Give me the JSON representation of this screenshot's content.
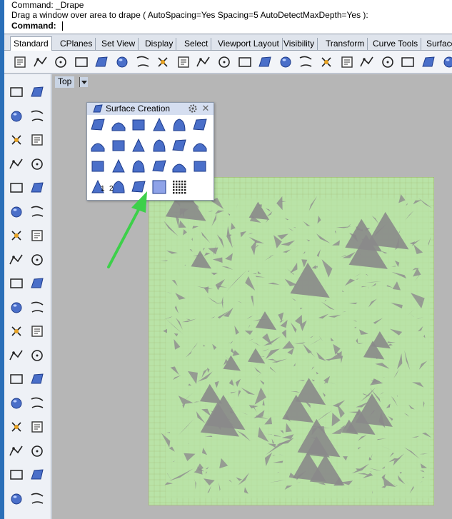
{
  "command": {
    "line1": "Command: _Drape",
    "line2": "Drag a window over area to drape ( AutoSpacing=Yes  Spacing=5  AutoDetectMaxDepth=Yes ):",
    "prompt": "Command:",
    "input_value": ""
  },
  "tabs": [
    "Standard",
    "CPlanes",
    "Set View",
    "Display",
    "Select",
    "Viewport Layout",
    "Visibility",
    "Transform",
    "Curve Tools",
    "Surface"
  ],
  "toolbar_icons": [
    "new-file-icon",
    "open-folder-icon",
    "save-icon",
    "print-icon",
    "import-icon",
    "cut-icon",
    "copy-icon",
    "paste-icon",
    "undo-icon",
    "pan-hand-icon",
    "rotate-view-icon",
    "zoom-icon",
    "zoom-window-icon",
    "zoom-extents-icon",
    "zoom-selected-icon",
    "rotate-camera-icon",
    "four-viewports-icon",
    "car-render-icon",
    "drafting-icon",
    "properties-icon",
    "snap-icon",
    "light-bulb-icon"
  ],
  "left_tools": [
    "select-arrow-icon",
    "point-icon",
    "polyline-icon",
    "curve-points-icon",
    "circle-icon",
    "ellipse-icon",
    "polygon-icon",
    "rectangle-icon",
    "arc-icon",
    "fillet-curve-icon",
    "surface-corner-icon",
    "surface-loft-icon",
    "box-solid-icon",
    "sphere-solid-icon",
    "cylinder-solid-icon",
    "mesh-plane-icon",
    "boolean-union-icon",
    "explode-icon",
    "trim-icon",
    "split-icon",
    "group-icon",
    "ungroup-icon",
    "offset-curve-icon",
    "offset-surface-icon",
    "text-icon",
    "scale-icon",
    "align-icon",
    "mirror-icon",
    "extrude-solid-icon",
    "dimension-icon",
    "array-icon",
    "gumball-icon",
    "project-icon",
    "check-icon",
    "analyze-icon",
    "render-icon"
  ],
  "viewport": {
    "title": "Top"
  },
  "panel": {
    "title": "Surface Creation",
    "icons": [
      "surface-from-points-icon",
      "surface-from-edge-icon",
      "surface-from-curves-icon",
      "sweep-surface-icon",
      "loft-surface-icon",
      "patch-surface-icon",
      "plane-surface-icon",
      "rectangular-plane-icon",
      "vertical-plane-icon",
      "network-surface-icon",
      "cutting-plane-icon",
      "heightfield-icon",
      "extrude-surface-icon",
      "extrude-tapered-icon",
      "rib-surface-icon",
      "cone-surface-icon",
      "rail-revolve-icon",
      "sweep-one-rail-icon",
      "revolve-surface-icon",
      "sweep-two-rails-icon",
      "drape-surface-icon",
      "surface-from-grid-icon",
      "point-grid-icon"
    ],
    "sweep_labels": [
      "1",
      "2"
    ]
  },
  "colors": {
    "mesh_fill": "#b9e3a7",
    "mesh_grid": "#9aa860",
    "viewport_bg": "#b6b6b6",
    "arrow": "#3dd04a",
    "icon_blue": "#4a6fc9"
  }
}
